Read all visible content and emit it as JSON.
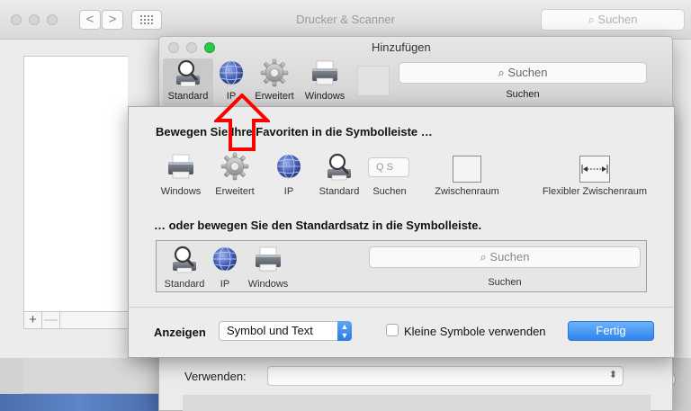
{
  "main_window": {
    "title": "Drucker & Scanner",
    "search_placeholder": "Suchen",
    "nav_back": "<",
    "nav_forward": ">",
    "grid_icon": "grid-icon",
    "add_label": "+",
    "remove_label": "—",
    "help_label": "?"
  },
  "add_window": {
    "title": "Hinzufügen",
    "toolbar": [
      {
        "label": "Standard",
        "icon": "magnifier-printer-icon"
      },
      {
        "label": "IP",
        "icon": "globe-icon"
      },
      {
        "label": "Erweitert",
        "icon": "gear-icon"
      },
      {
        "label": "Windows",
        "icon": "printer-icon"
      }
    ],
    "search_placeholder": "Suchen",
    "search_label": "Suchen",
    "use_label": "Verwenden:"
  },
  "customize_sheet": {
    "heading_favorites": "Bewegen Sie Ihre Favoriten in die Symbolleiste …",
    "palette": [
      {
        "label": "Windows",
        "icon": "printer-icon"
      },
      {
        "label": "Erweitert",
        "icon": "gear-icon"
      },
      {
        "label": "IP",
        "icon": "globe-icon"
      },
      {
        "label": "Standard",
        "icon": "magnifier-printer-icon"
      },
      {
        "label": "Suchen",
        "icon": "search-field-icon"
      },
      {
        "label": "Zwischenraum",
        "icon": "space-icon"
      },
      {
        "label": "Flexibler Zwischenraum",
        "icon": "flexible-space-icon"
      }
    ],
    "mini_search_text": "Q S",
    "heading_default": "… oder bewegen Sie den Standardsatz in die Symbolleiste.",
    "default_set": [
      {
        "label": "Standard",
        "icon": "magnifier-printer-icon"
      },
      {
        "label": "IP",
        "icon": "globe-icon"
      },
      {
        "label": "Windows",
        "icon": "printer-icon"
      }
    ],
    "default_search_placeholder": "Suchen",
    "default_search_label": "Suchen",
    "show_label": "Anzeigen",
    "show_value": "Symbol und Text",
    "small_icons_label": "Kleine Symbole verwenden",
    "small_icons_checked": false,
    "done_label": "Fertig",
    "accent_color": "#2e84ee"
  },
  "annotation": {
    "icon": "red-arrow-up-icon",
    "color": "#ff0000"
  }
}
